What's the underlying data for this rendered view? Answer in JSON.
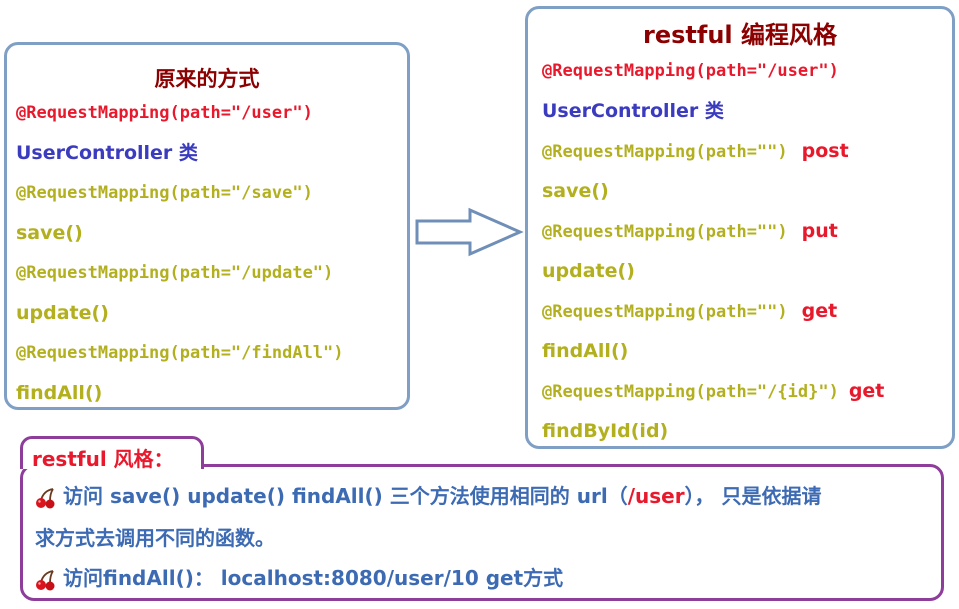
{
  "left": {
    "title": "原来的方式",
    "class_mapping": "@RequestMapping(path=\"/user\")",
    "class_name": "UserController 类",
    "methods": [
      {
        "mapping": "@RequestMapping(path=\"/save\")",
        "name": "save()"
      },
      {
        "mapping": "@RequestMapping(path=\"/update\")",
        "name": "update()"
      },
      {
        "mapping": "@RequestMapping(path=\"/findAll\")",
        "name": "findAll()"
      }
    ]
  },
  "right": {
    "title": "restful 编程风格",
    "class_mapping": "@RequestMapping(path=\"/user\")",
    "class_name": "UserController 类",
    "methods": [
      {
        "mapping": "@RequestMapping(path=\"\")",
        "verb": "post",
        "name": "save()"
      },
      {
        "mapping": "@RequestMapping(path=\"\")",
        "verb": "put",
        "name": "update()"
      },
      {
        "mapping": "@RequestMapping(path=\"\")",
        "verb": "get",
        "name": "findAll()"
      },
      {
        "mapping": "@RequestMapping(path=\"/{id}\")",
        "verb": "get",
        "name": "findById(id)"
      }
    ]
  },
  "summary": {
    "label": "restful 风格：",
    "line1_a": "访问 save() update() findAll() 三个方法使用相同的 url（",
    "line1_url": "/user",
    "line1_b": "），  只是依据请",
    "line2": "求方式去调用不同的函数。",
    "line3": "访问findAll()：  localhost:8080/user/10 get方式"
  },
  "colors": {
    "title": "#8b0000",
    "class_mapping": "#e8192c",
    "class_name": "#3b3bbf",
    "method": "#b3b01f",
    "verb": "#e8192c",
    "box_border": "#7f9fc5",
    "summary_border": "#8e3d9a",
    "summary_text": "#3d6bb3"
  }
}
